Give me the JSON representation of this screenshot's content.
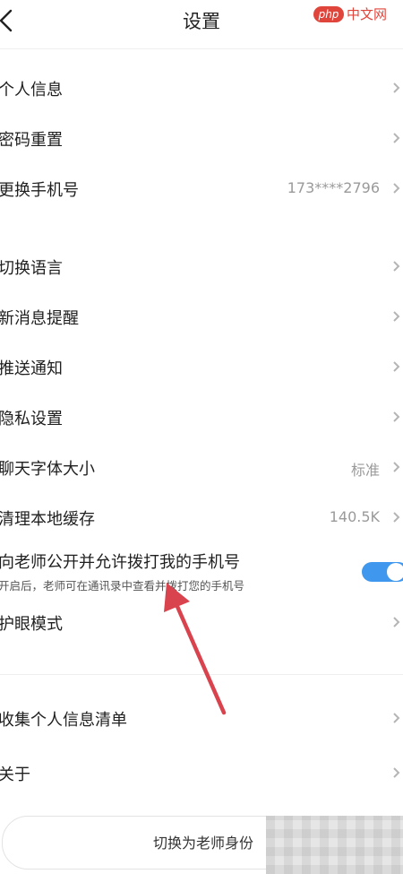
{
  "header": {
    "title": "设置",
    "back_icon": "chevron-left-icon",
    "watermark_logo": "php",
    "watermark_text": "中文网"
  },
  "group1": [
    {
      "label": "个人信息",
      "value": ""
    },
    {
      "label": "密码重置",
      "value": ""
    },
    {
      "label": "更换手机号",
      "value": "173****2796"
    }
  ],
  "group2": [
    {
      "label": "切换语言",
      "value": ""
    },
    {
      "label": "新消息提醒",
      "value": ""
    },
    {
      "label": "推送通知",
      "value": ""
    },
    {
      "label": "隐私设置",
      "value": ""
    },
    {
      "label": "聊天字体大小",
      "value": "标准"
    },
    {
      "label": "清理本地缓存",
      "value": "140.5K"
    }
  ],
  "phone_toggle": {
    "label": "向老师公开并允许拨打我的手机号",
    "desc": "开启后，老师可在通讯录中查看并拨打您的手机号",
    "on": true
  },
  "eye_mode": {
    "label": "护眼模式"
  },
  "group3": [
    {
      "label": "收集个人信息清单",
      "value": ""
    },
    {
      "label": "关于",
      "value": ""
    }
  ],
  "switch_button": {
    "label": "切换为老师身份"
  },
  "colors": {
    "accent": "#3f98ee",
    "arrow": "#d9434e",
    "watermark": "#e0453b"
  }
}
